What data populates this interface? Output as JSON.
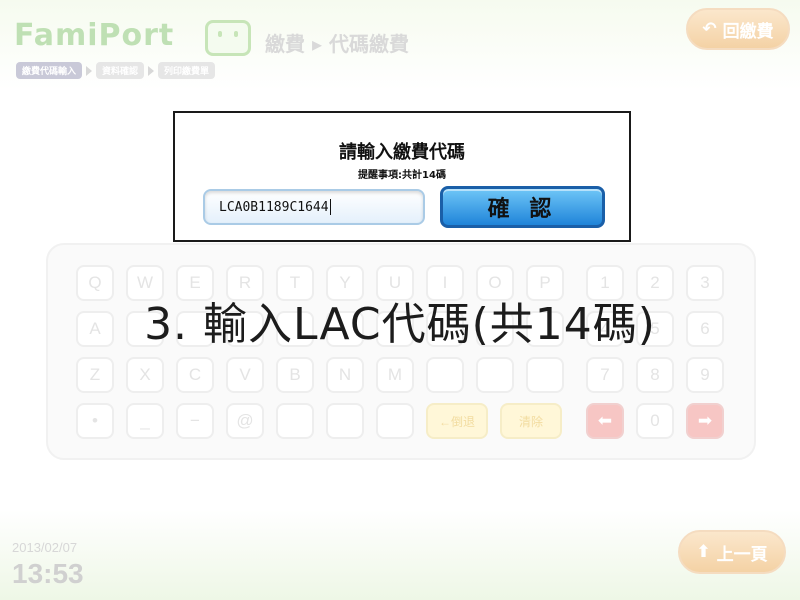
{
  "header": {
    "logo": "FamiPort",
    "breadcrumb": "繳費 ▸ 代碼繳費",
    "back_button": "回繳費",
    "steps": [
      "繳費代碼輸入",
      "資料確認",
      "列印繳費單"
    ]
  },
  "dialog": {
    "title": "請輸入繳費代碼",
    "subtitle": "提醒事項:共計14碼",
    "input_value": "LCA0B1189C1644",
    "confirm_label": "確 認"
  },
  "instruction": "3. 輸入LAC代碼(共14碼)",
  "keyboard": {
    "row1": [
      "Q",
      "W",
      "E",
      "R",
      "T",
      "Y",
      "U",
      "I",
      "O",
      "P",
      "1",
      "2",
      "3"
    ],
    "row2": [
      "A",
      "",
      "",
      "",
      "",
      "",
      "",
      "",
      "",
      "",
      "4",
      "5",
      "6"
    ],
    "row3": [
      "Z",
      "X",
      "C",
      "V",
      "B",
      "N",
      "M",
      "",
      "",
      "",
      "7",
      "8",
      "9"
    ],
    "row4": [
      "•",
      "_",
      "−",
      "@",
      "",
      "",
      "",
      "←倒退",
      "清除",
      "⬅",
      "0",
      "➡"
    ]
  },
  "footer": {
    "date": "2013/02/07",
    "time": "13:53",
    "prev_button": "上一頁"
  },
  "colors": {
    "accent_blue": "#1f84d9",
    "logo_green": "#bfe0b4",
    "button_orange": "#f4d2a5"
  }
}
